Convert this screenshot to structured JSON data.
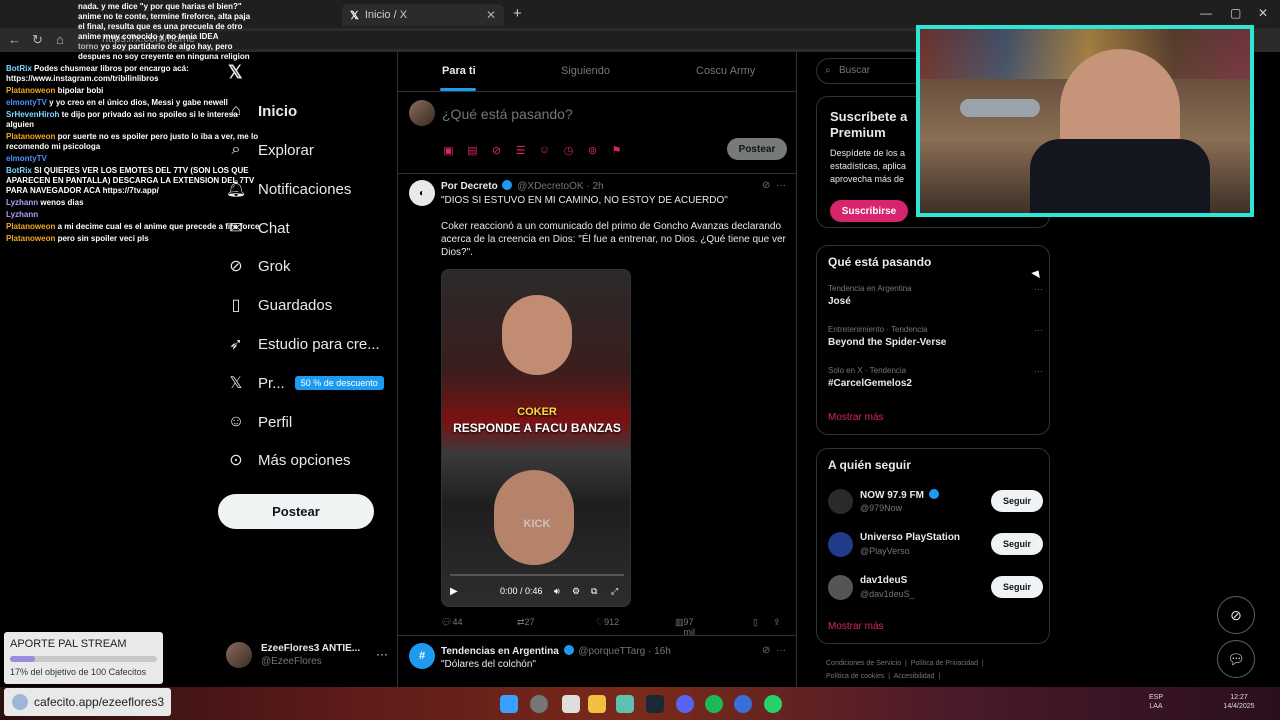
{
  "browser": {
    "tabs": [
      {
        "label": "Inicio / X",
        "active": true
      }
    ],
    "address": "https://x.com/home",
    "new_tab": "+"
  },
  "chat_overlay": {
    "top_lines": [
      {
        "user": "",
        "text": "nada. y me dice \"y por que harias el bien?\""
      },
      {
        "user": "",
        "text": "anime no te conte, termine fireforce, alta paja el final, resulta que es una precuela de otro anime muy conocido y no tenia IDEA"
      },
      {
        "user": "torno",
        "text": "yo soy partidario de algo hay, pero despues no soy creyente en ninguna religion"
      }
    ],
    "lines": [
      {
        "user": "BotRix",
        "text": "Podes chusmear libros por encargo acá: https://www.instagram.com/tribilinlibros",
        "color": "#7fd7ff"
      },
      {
        "user": "Platanoweon",
        "text": "bipolar bobi",
        "color": "#f5a623"
      },
      {
        "user": "elmontyTV",
        "text": "y yo creo en el único dios, Messi y gabe newell",
        "color": "#4a90ff"
      },
      {
        "user": "SrHevenHiroh",
        "text": "te dijo por privado asi no spoileo si le interesa alguien",
        "color": "#7fd7ff"
      },
      {
        "user": "Platanoweon",
        "text": "por suerte no es spoiler pero justo lo iba a ver, me lo recomendo mi psicologa",
        "color": "#f5a623"
      },
      {
        "user": "elmontyTV",
        "text": "",
        "color": "#4a90ff"
      },
      {
        "user": "BotRix",
        "text": "SI QUIERES VER LOS EMOTES DEL 7TV (SON LOS QUE APARECEN EN PANTALLA) DESCARGA LA EXTENSION DEL 7TV PARA NAVEGADOR ACA https://7tv.app/",
        "color": "#7fd7ff"
      },
      {
        "user": "Lyzhann",
        "text": "wenos dias",
        "color": "#b19cff"
      },
      {
        "user": "Lyzhann",
        "text": "",
        "color": "#b19cff"
      },
      {
        "user": "Platanoweon",
        "text": "a mi decime cual es el anime que precede a fire force",
        "color": "#f5a623"
      },
      {
        "user": "Platanoweon",
        "text": "pero sin spoiler veci pls",
        "color": "#f5a623"
      }
    ]
  },
  "nav": {
    "items": [
      {
        "label": "Inicio",
        "icon": "home-icon",
        "active": true
      },
      {
        "label": "Explorar",
        "icon": "search-icon"
      },
      {
        "label": "Notificaciones",
        "icon": "bell-icon"
      },
      {
        "label": "Chat",
        "icon": "mail-icon"
      },
      {
        "label": "Grok",
        "icon": "grok-icon"
      },
      {
        "label": "Guardados",
        "icon": "bookmark-icon"
      },
      {
        "label": "Estudio para cre...",
        "icon": "rocket-icon"
      },
      {
        "label": "Pr...",
        "icon": "x-logo-icon",
        "badge": "50 % de descuento"
      },
      {
        "label": "Perfil",
        "icon": "person-icon"
      },
      {
        "label": "Más opciones",
        "icon": "more-circle-icon"
      }
    ],
    "post_button": "Postear",
    "profile": {
      "name": "EzeeFlores3 ANTIE...",
      "handle": "@EzeeFlores"
    }
  },
  "main": {
    "tabs": [
      "Para ti",
      "Siguiendo",
      "Coscu Army"
    ],
    "composer": {
      "placeholder": "¿Qué está pasando?",
      "post_label": "Postear"
    },
    "tweet": {
      "name": "Por Decreto",
      "handle": "@XDecretoOK",
      "time": "2h",
      "headline": "\"DIOS SI ESTUVO EN MI CAMINO, NO ESTOY DE ACUERDO\"",
      "body": "Coker reaccionó a un comunicado del primo de Goncho Avanzas declarando acerca de la creencia en Dios: \"Él fue a entrenar, no Dios. ¿Qué tiene que ver Dios?\".",
      "video": {
        "caption1": "COKER",
        "caption2": "RESPONDE A FACU BANZAS",
        "watermark": "KICK",
        "time": "0:00 / 0:46"
      },
      "stats": {
        "replies": "44",
        "reposts": "27",
        "likes": "912",
        "views": "97 mil"
      }
    },
    "tweet2": {
      "name": "Tendencias en Argentina",
      "handle": "@porqueTTarg",
      "time": "16h",
      "body": "\"Dólares del colchón\""
    }
  },
  "right": {
    "search_placeholder": "Buscar",
    "premium": {
      "title": "Suscríbete a Premium",
      "desc": "Despídete de los a estadísticas, aplica aprovecha más de",
      "button": "Suscribirse"
    },
    "trends": {
      "title": "Qué está pasando",
      "items": [
        {
          "category": "Tendencia en Argentina",
          "name": "José"
        },
        {
          "category": "Entretenimiento · Tendencia",
          "name": "Beyond the Spider-Verse"
        },
        {
          "category": "Solo en X · Tendencia",
          "name": "#CarcelGemelos2"
        }
      ],
      "more": "Mostrar más"
    },
    "follow": {
      "title": "A quién seguir",
      "items": [
        {
          "name": "NOW 97.9 FM",
          "handle": "@979Now",
          "button": "Seguir",
          "color": "#2a2a2a"
        },
        {
          "name": "Universo PlayStation",
          "handle": "@PlayVerso",
          "button": "Seguir",
          "color": "#1f3b8a"
        },
        {
          "name": "dav1deuS",
          "handle": "@dav1deuS_",
          "button": "Seguir",
          "color": "#555"
        }
      ],
      "more": "Mostrar más"
    },
    "footer": [
      "Condiciones de Servicio",
      "Política de Privacidad",
      "Política de cookies",
      "Accesibilidad"
    ]
  },
  "aporte": {
    "title": "APORTE PAL STREAM",
    "progress": 0.17,
    "sub": "17% del objetivo de 100 Cafecitos"
  },
  "cafecito": "cafecito.app/ezeeflores3",
  "taskbar": {
    "lang": "ESP LAA",
    "time": "12:27",
    "date": "14/4/2025"
  }
}
